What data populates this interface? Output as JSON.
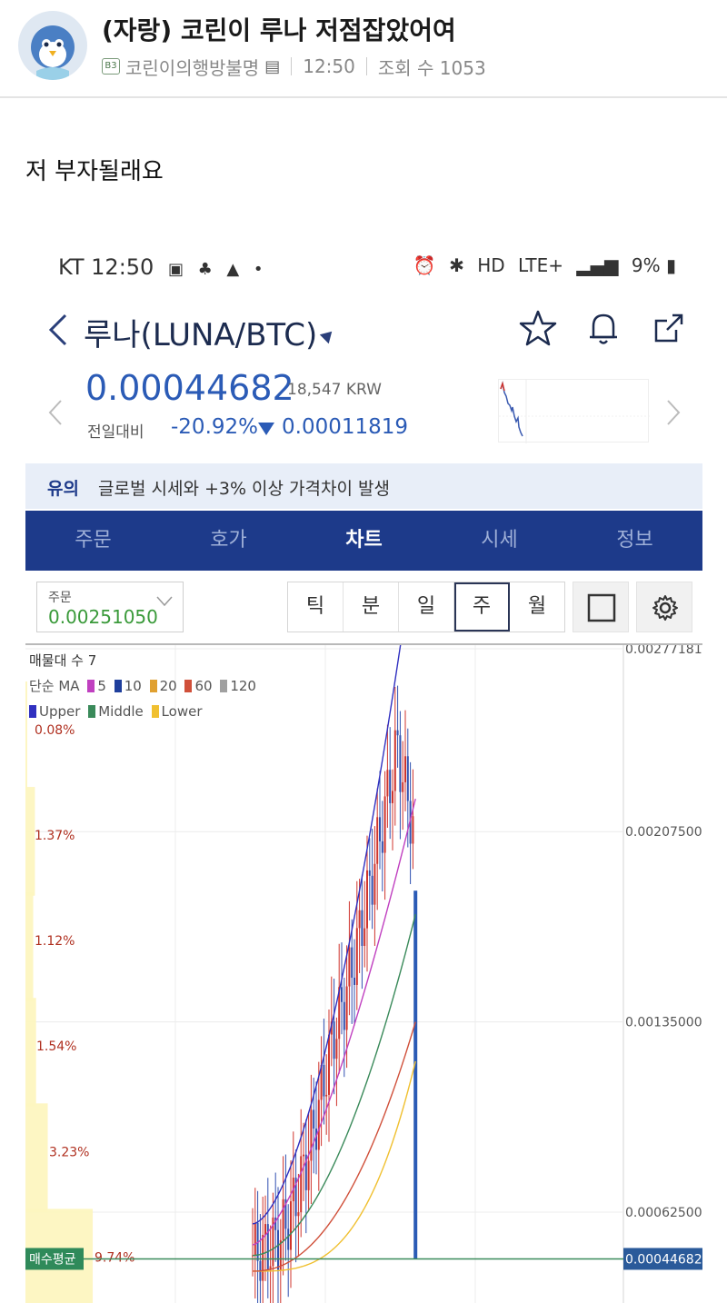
{
  "post": {
    "title": "(자랑) 코린이 루나 저점잡았어여",
    "author_level": "B3",
    "author": "코린이의행방불명",
    "time": "12:50",
    "views": "조회 수 1053",
    "body": "저 부자될래요"
  },
  "screenshot": {
    "status_bar": {
      "carrier_time": "KT 12:50",
      "battery": "9%",
      "network": "LTE+"
    },
    "header": {
      "title": "루나(LUNA/BTC)",
      "icons": [
        "back-icon",
        "star-icon",
        "bell-icon",
        "share-icon"
      ]
    },
    "price": {
      "current": "0.00044682",
      "krw": "18,547 KRW",
      "change_label": "전일대비",
      "change_pct": "-20.92%",
      "change_amt": "0.00011819",
      "colors": {
        "down": "#2b5bb6",
        "up": "#d0342c"
      }
    },
    "notice": {
      "tag": "유의",
      "text": "글로벌 시세와 +3% 이상 가격차이 발생"
    },
    "tabs": [
      "주문",
      "호가",
      "차트",
      "시세",
      "정보"
    ],
    "active_tab": "차트",
    "order": {
      "label": "주문",
      "value": "0.00251050"
    },
    "periods": [
      "틱",
      "분",
      "일",
      "주",
      "월"
    ],
    "active_period": "주",
    "chart": {
      "title": "매물대 수 7",
      "ma_label": "단순 MA",
      "ma_legend": [
        {
          "name": "5",
          "color": "#c040c0"
        },
        {
          "name": "10",
          "color": "#1f3f9c"
        },
        {
          "name": "20",
          "color": "#e0a030"
        },
        {
          "name": "60",
          "color": "#d0503a"
        },
        {
          "name": "120",
          "color": "#a0a0a0"
        }
      ],
      "bb_legend": [
        {
          "name": "Upper",
          "color": "#3030c0"
        },
        {
          "name": "Middle",
          "color": "#3a8a5a"
        },
        {
          "name": "Lower",
          "color": "#f0c030"
        }
      ]
    }
  },
  "chart_data": {
    "type": "bar",
    "title": "매물대 수 7",
    "y_axis_labels": [
      "0.00277181",
      "0.00207500",
      "0.00135000",
      "0.00062500"
    ],
    "y_ticks": [
      0.00277181,
      0.002075,
      0.00135,
      0.000625
    ],
    "ylim": [
      0.0004,
      0.00277181
    ],
    "current_price": 0.00044682,
    "current_price_label": "0.00044682",
    "avg_buy_label": "매수평균",
    "volume_profile": [
      {
        "label": "0.08%",
        "level": 0.0
      },
      {
        "label": "1.37%",
        "level": 0.137
      },
      {
        "label": "1.12%",
        "level": 0.112
      },
      {
        "label": "1.54%",
        "level": 0.154
      },
      {
        "label": "3.23%",
        "level": 0.323
      },
      {
        "label": "9.74%",
        "level": 0.974
      }
    ],
    "series": [
      {
        "name": "Upper"
      },
      {
        "name": "Middle"
      },
      {
        "name": "Lower"
      }
    ]
  }
}
